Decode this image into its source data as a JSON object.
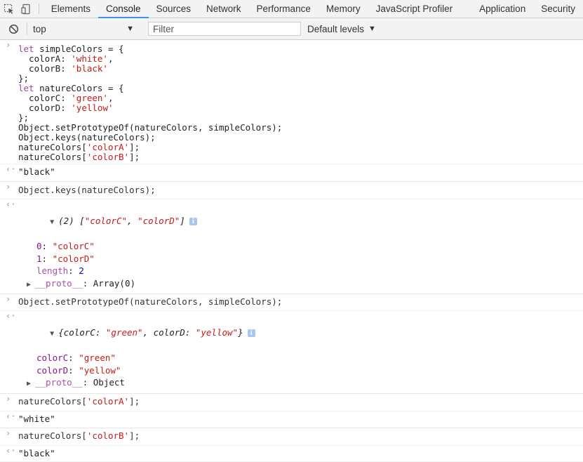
{
  "devtools": {
    "tabs": [
      {
        "label": "Elements"
      },
      {
        "label": "Console"
      },
      {
        "label": "Sources"
      },
      {
        "label": "Network"
      },
      {
        "label": "Performance"
      },
      {
        "label": "Memory"
      },
      {
        "label": "JavaScript Profiler"
      },
      {
        "label": "Application"
      },
      {
        "label": "Security"
      }
    ],
    "active_tab": "Console",
    "accent_color": "#4b8bf4"
  },
  "filterbar": {
    "context": "top",
    "filter_placeholder": "Filter",
    "levels_label": "Default levels"
  },
  "console": {
    "input1": {
      "l1a": "let",
      "l1b": " simpleColors = {",
      "l2a": "  colorA: ",
      "l2b": "'white'",
      "l2c": ",",
      "l3a": "  colorB: ",
      "l3b": "'black'",
      "l4": "};",
      "l5a": "let",
      "l5b": " natureColors = {",
      "l6a": "  colorC: ",
      "l6b": "'green'",
      "l6c": ",",
      "l7a": "  colorD: ",
      "l7b": "'yellow'",
      "l8": "};",
      "l9": "Object.setPrototypeOf(natureColors, simpleColors);",
      "l10": "Object.keys(natureColors);",
      "l11a": "natureColors[",
      "l11b": "'colorA'",
      "l11c": "];",
      "l12a": "natureColors[",
      "l12b": "'colorB'",
      "l12c": "];"
    },
    "result1": "\"black\"",
    "input2": "Object.keys(natureColors);",
    "result2": {
      "head_a": "(2) [",
      "head_b": "\"colorC\"",
      "head_c": ", ",
      "head_d": "\"colorD\"",
      "head_e": "]",
      "i0_key": "0",
      "i0_val": "\"colorC\"",
      "i1_key": "1",
      "i1_val": "\"colorD\"",
      "len_key": "length",
      "len_val": "2",
      "proto_key": "__proto__",
      "proto_val": ": Array(0)"
    },
    "input3": "Object.setPrototypeOf(natureColors, simpleColors);",
    "result3": {
      "head_a": "{colorC: ",
      "head_b": "\"green\"",
      "head_c": ", colorD: ",
      "head_d": "\"yellow\"",
      "head_e": "}",
      "c_key": "colorC",
      "c_val": "\"green\"",
      "d_key": "colorD",
      "d_val": "\"yellow\"",
      "proto_key": "__proto__",
      "proto_val": ": Object"
    },
    "input4a": "natureColors[",
    "input4b": "'colorA'",
    "input4c": "];",
    "result4": "\"white\"",
    "input5a": "natureColors[",
    "input5b": "'colorB'",
    "input5c": "];",
    "result5": "\"black\"",
    "prompt_symbol": "›",
    "result_symbol": "‹·",
    "info_symbol": "i"
  }
}
